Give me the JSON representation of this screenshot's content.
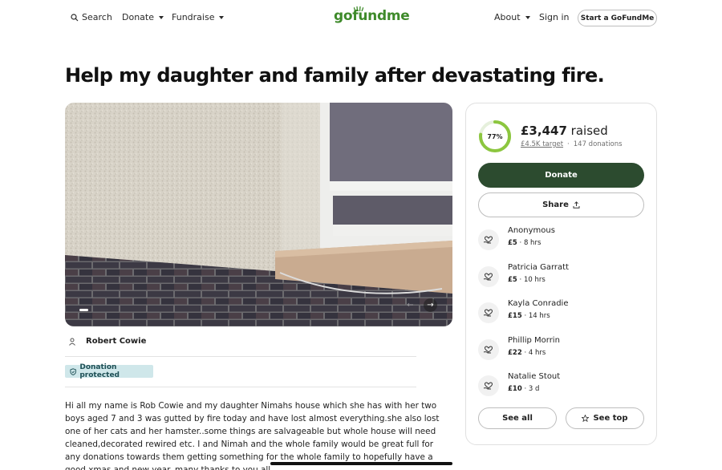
{
  "header": {
    "search_label": "Search",
    "donate_label": "Donate",
    "fundraise_label": "Fundraise",
    "logo_text": "gofundme",
    "about_label": "About",
    "signin_label": "Sign in",
    "start_label": "Start a GoFundMe"
  },
  "campaign": {
    "title": "Help my daughter and family after devastating fire.",
    "organizer": "Robert Cowie",
    "protected_label": "Donation protected",
    "story_lines": [
      "Hi all my name is Rob Cowie and my daughter Nimahs house which she has with her two",
      "boys aged 7 and 3 was gutted by fire today and have lost almost everything.she also lost",
      "one of her cats and her hamster..some things are salvageable but whole house will need",
      "cleaned,decorated rewired etc. I and Nimah and the whole family would be great full for",
      "any donations towards them getting something for the whole family to hopefully have a",
      "good xmas and new year..many thanks to you all"
    ]
  },
  "progress": {
    "percent": 77,
    "percent_label": "77%",
    "raised_amount": "£3,447",
    "raised_suffix": "raised",
    "target": "£4.5K target",
    "separator": "·",
    "donations": "147 donations"
  },
  "actions": {
    "donate_label": "Donate",
    "share_label": "Share",
    "see_all_label": "See all",
    "see_top_label": "See top"
  },
  "donors": [
    {
      "name": "Anonymous",
      "amount": "£5",
      "time": " · 8 hrs"
    },
    {
      "name": "Patricia Garratt",
      "amount": "£5",
      "time": " · 10 hrs"
    },
    {
      "name": "Kayla Conradie",
      "amount": "£15",
      "time": " · 14 hrs"
    },
    {
      "name": "Phillip Morrin",
      "amount": "£22",
      "time": " · 4 hrs"
    },
    {
      "name": "Natalie Stout",
      "amount": "£10",
      "time": " · 3 d"
    }
  ],
  "colors": {
    "brand_green": "#3e8a2a",
    "donate_button": "#2c4b2f",
    "ring_progress": "#8cc63f",
    "protected_badge_bg": "#cfe7ea"
  },
  "icons": {
    "search": "search-icon",
    "organizer": "person-icon",
    "protected": "shield-icon",
    "share": "share-upload-icon",
    "donor": "heart-hand-icon",
    "see_top": "star-icon"
  }
}
